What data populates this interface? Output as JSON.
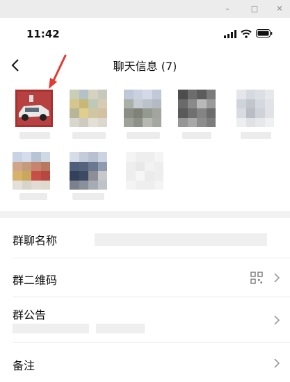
{
  "window": {
    "minimize_glyph": "–",
    "restore_glyph": "□",
    "close_glyph": "✕"
  },
  "status": {
    "time": "11:42"
  },
  "nav": {
    "title": "聊天信息 (7)"
  },
  "rows": {
    "name": {
      "label": "群聊名称"
    },
    "qrcode": {
      "label": "群二维码"
    },
    "notice": {
      "label": "群公告"
    },
    "remark": {
      "label": "备注"
    }
  },
  "colors": {
    "accent_arrow": "#e53935"
  },
  "icons": [
    "back-arrow-icon",
    "signal-icon",
    "wifi-icon",
    "battery-icon",
    "qr-code-icon",
    "chevron-right-icon"
  ]
}
